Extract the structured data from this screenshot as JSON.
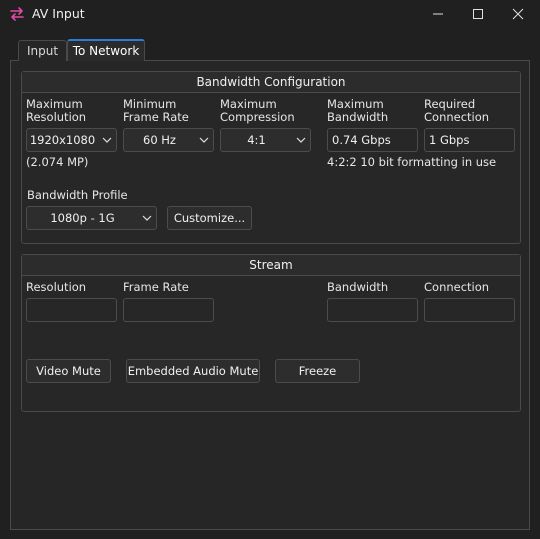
{
  "window": {
    "title": "AV Input"
  },
  "tabs": [
    {
      "label": "Input"
    },
    {
      "label": "To Network"
    }
  ],
  "bandwidth": {
    "header": "Bandwidth Configuration",
    "max_resolution_label": "Maximum\nResolution",
    "min_frame_rate_label": "Minimum\nFrame Rate",
    "max_compression_label": "Maximum\nCompression",
    "max_bandwidth_label": "Maximum\nBandwidth",
    "required_connection_label": "Required\nConnection",
    "resolution_value": "1920x1080",
    "frame_rate_value": "60 Hz",
    "compression_value": "4:1",
    "bandwidth_value": "0.74 Gbps",
    "connection_value": "1 Gbps",
    "megapixels": "(2.074 MP)",
    "formatting_note": "4:2:2 10 bit formatting in use",
    "profile_label": "Bandwidth Profile",
    "profile_value": "1080p - 1G",
    "customize_label": "Customize..."
  },
  "stream": {
    "header": "Stream",
    "resolution_label": "Resolution",
    "frame_rate_label": "Frame Rate",
    "bandwidth_label": "Bandwidth",
    "connection_label": "Connection",
    "resolution_value": "",
    "frame_rate_value": "",
    "bandwidth_value": "",
    "connection_value": "",
    "video_mute_label": "Video Mute",
    "audio_mute_label": "Embedded Audio Mute",
    "freeze_label": "Freeze"
  },
  "icons": {
    "app": "swap-arrows-icon",
    "minimize": "minimize-icon",
    "maximize": "maximize-icon",
    "close": "close-icon",
    "dropdown": "chevron-down-icon"
  },
  "colors": {
    "background": "#202020",
    "accent": "#2f7bd6",
    "app_icon": "#e04aa6"
  }
}
